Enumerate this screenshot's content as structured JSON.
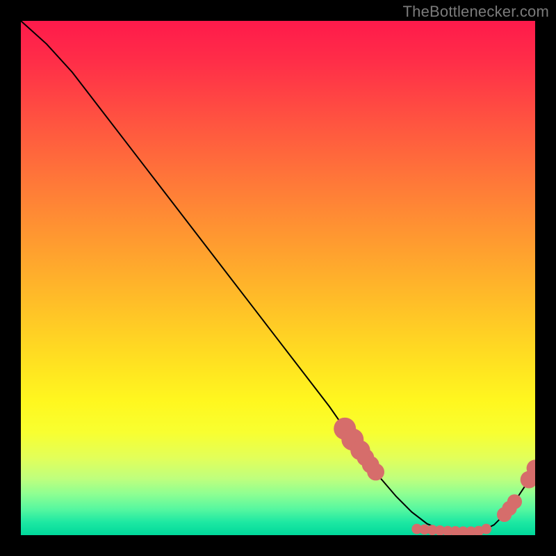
{
  "watermark": "TheBottlenecker.com",
  "chart_data": {
    "type": "line",
    "title": "",
    "xlabel": "",
    "ylabel": "",
    "xlim": [
      0,
      100
    ],
    "ylim": [
      0,
      100
    ],
    "x": [
      0,
      5,
      10,
      15,
      20,
      25,
      30,
      35,
      40,
      45,
      50,
      55,
      60,
      63,
      66,
      68,
      70,
      73,
      76,
      79,
      82,
      85,
      88,
      90,
      92,
      94,
      96,
      98,
      100
    ],
    "y": [
      100,
      95.5,
      90,
      83.5,
      77,
      70.5,
      64,
      57.5,
      51,
      44.5,
      38,
      31.5,
      25,
      20.7,
      16.5,
      13.7,
      11,
      7.5,
      4.5,
      2.2,
      1.0,
      0.7,
      0.7,
      1.0,
      2.0,
      4.0,
      6.5,
      9.5,
      13
    ],
    "markers": [
      {
        "x": 63,
        "y": 20.7,
        "r": 4.5
      },
      {
        "x": 64.5,
        "y": 18.6,
        "r": 4.5
      },
      {
        "x": 66,
        "y": 16.5,
        "r": 4.0
      },
      {
        "x": 67,
        "y": 15.1,
        "r": 3.5
      },
      {
        "x": 68,
        "y": 13.7,
        "r": 3.5
      },
      {
        "x": 69,
        "y": 12.3,
        "r": 3.5
      },
      {
        "x": 77,
        "y": 1.2,
        "r": 2.1
      },
      {
        "x": 78.5,
        "y": 1.1,
        "r": 2.1
      },
      {
        "x": 80,
        "y": 1.0,
        "r": 2.1
      },
      {
        "x": 81.5,
        "y": 0.9,
        "r": 2.1
      },
      {
        "x": 83,
        "y": 0.8,
        "r": 2.1
      },
      {
        "x": 84.5,
        "y": 0.75,
        "r": 2.1
      },
      {
        "x": 86,
        "y": 0.7,
        "r": 2.1
      },
      {
        "x": 87.5,
        "y": 0.7,
        "r": 2.1
      },
      {
        "x": 89,
        "y": 0.8,
        "r": 2.1
      },
      {
        "x": 90.5,
        "y": 1.2,
        "r": 2.1
      },
      {
        "x": 94,
        "y": 4.0,
        "r": 3.0
      },
      {
        "x": 95,
        "y": 5.2,
        "r": 3.0
      },
      {
        "x": 96,
        "y": 6.5,
        "r": 3.0
      },
      {
        "x": 98.8,
        "y": 10.8,
        "r": 3.5
      },
      {
        "x": 100,
        "y": 13,
        "r": 3.5
      }
    ],
    "colors": {
      "line": "#000000",
      "marker": "#d66d6b"
    }
  }
}
